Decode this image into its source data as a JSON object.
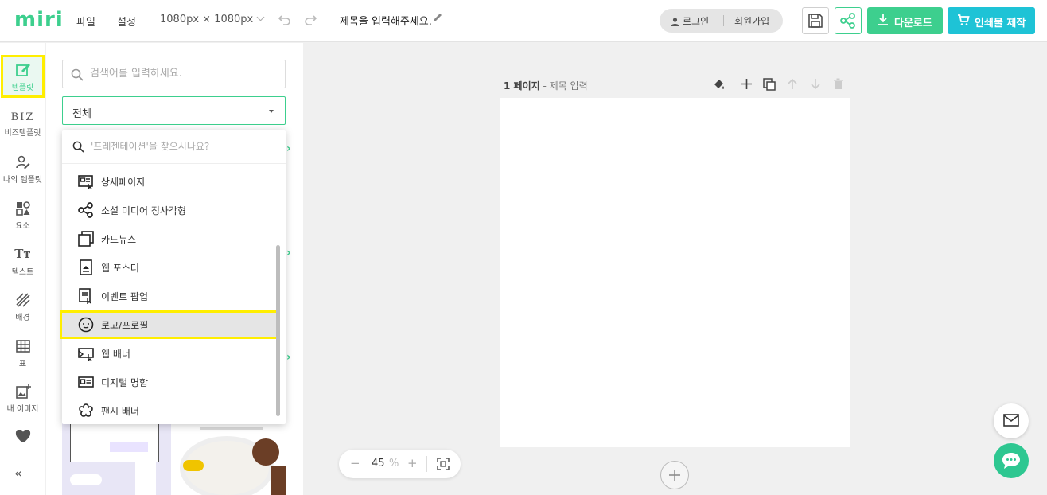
{
  "header": {
    "logo": "miri",
    "menu_file": "파일",
    "menu_settings": "설정",
    "canvas_size": "1080px × 1080px",
    "title": "제목을 입력해주세요.",
    "login": "로그인",
    "signup": "회원가입",
    "download": "다운로드",
    "print": "인쇄물 제작",
    "accent": "#3dcf8e",
    "print_color": "#1ec3d6"
  },
  "rail": {
    "template": "템플릿",
    "biz_badge": "BIZ",
    "biz_template": "비즈템플릿",
    "my_template": "나의 템플릿",
    "elements": "요소",
    "text": "텍스트",
    "text_icon": "Tт",
    "background": "배경",
    "table": "표",
    "my_images": "내 이미지",
    "collapse": "«"
  },
  "panel": {
    "search_placeholder": "검색어를 입력하세요.",
    "category_selected": "전체"
  },
  "dropdown": {
    "search_placeholder": "'프레젠테이션'을 찾으시나요?",
    "items": [
      {
        "label": "상세페이지",
        "icon": "detail-page-icon"
      },
      {
        "label": "소셜 미디어 정사각형",
        "icon": "share-nodes-icon"
      },
      {
        "label": "카드뉴스",
        "icon": "cards-icon"
      },
      {
        "label": "웹 포스터",
        "icon": "poster-icon"
      },
      {
        "label": "이벤트 팝업",
        "icon": "popup-icon"
      },
      {
        "label": "로고/프로필",
        "icon": "smile-icon"
      },
      {
        "label": "웹 배너",
        "icon": "banner-icon"
      },
      {
        "label": "디지털 명함",
        "icon": "business-card-icon"
      },
      {
        "label": "팬시 배너",
        "icon": "flower-icon"
      }
    ]
  },
  "canvas": {
    "page_number": "1 페이지",
    "page_title": "- 제목 입력",
    "zoom_value": "45",
    "zoom_unit": "%"
  }
}
